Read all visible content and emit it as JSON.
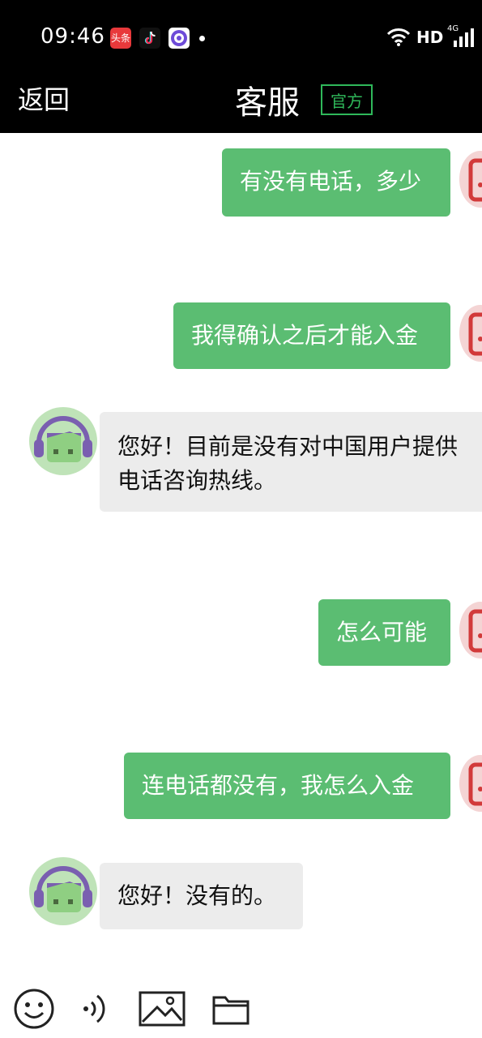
{
  "status_bar": {
    "time": "09:46",
    "badge_toutiao": "头条",
    "network": "HD",
    "signal_label": "4G"
  },
  "nav": {
    "back_label": "返回",
    "title": "客服",
    "official_badge": "官方"
  },
  "messages": [
    {
      "side": "out",
      "text": "有没有电话，多少"
    },
    {
      "side": "out",
      "text": "我得确认之后才能入金"
    },
    {
      "side": "in",
      "text": "您好！目前是没有对中国用户提供电话咨询热线。"
    },
    {
      "side": "out",
      "text": "怎么可能"
    },
    {
      "side": "out",
      "text": "连电话都没有，我怎么入金"
    },
    {
      "side": "in",
      "text": "您好！没有的。"
    }
  ],
  "toolbar": {
    "icons": [
      "emoji-icon",
      "voice-icon",
      "image-icon",
      "folder-icon"
    ]
  },
  "colors": {
    "accent_green": "#5bbd72",
    "official_green": "#2fb85a",
    "incoming_bubble": "#ececec"
  }
}
